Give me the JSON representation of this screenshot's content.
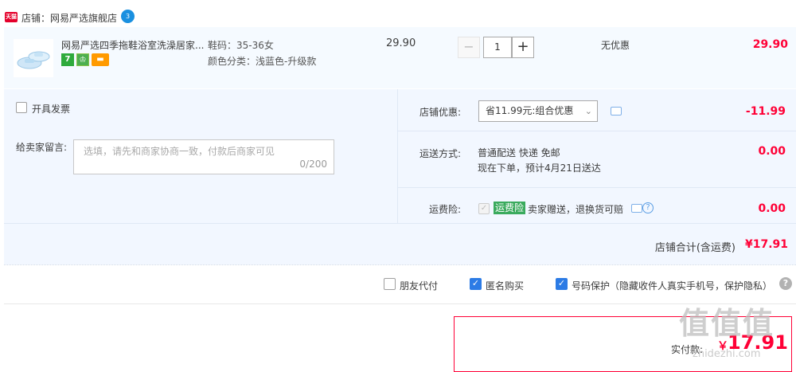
{
  "shop": {
    "badge_text": "天猫",
    "label": "店铺：网易严选旗舰店",
    "ww_icon_text": "3"
  },
  "item": {
    "title": "网易严选四季拖鞋浴室洗澡居家...",
    "badge_seven": "7",
    "sku_size": "鞋码：35-36女",
    "sku_color": "颜色分类：浅蓝色-升级款",
    "price": "29.90",
    "qty_minus": "−",
    "quantity": "1",
    "qty_plus": "+",
    "discount": "无优惠",
    "subtotal": "29.90"
  },
  "options": {
    "invoice_label": "开具发票",
    "message_label": "给卖家留言:",
    "message_placeholder": "选填，请先和商家协商一致，付款后商家可见",
    "message_count": "0/200",
    "shop_discount_label": "店铺优惠:",
    "shop_discount_selected": "省11.99元:组合优惠",
    "shop_discount_amount": "-11.99",
    "delivery_label": "运送方式:",
    "delivery_method": "普通配送 快递 免邮",
    "delivery_time": "现在下单，预计4月21日送达",
    "delivery_amount": "0.00",
    "insurance_label": "运费险:",
    "insurance_tag": "运费险",
    "insurance_text": "卖家赠送，退换货可赔",
    "insurance_amount": "0.00",
    "shop_total_label": "店铺合计(含运费)",
    "shop_total": "¥17.91"
  },
  "bottom": {
    "friend_pay": "朋友代付",
    "anonymous": "匿名购买",
    "number_protect": "号码保护（隐藏收件人真实手机号，保护隐私）",
    "help": "?"
  },
  "pay": {
    "label": "实付款:",
    "currency": "￥",
    "amount": "17.91"
  },
  "watermark": {
    "text": "值值值",
    "sub": "zhidezhi.com"
  },
  "colors": {
    "price_red": "#ff0036",
    "accent_blue": "#2c7be5",
    "panel_bg": "#f2f7ff"
  }
}
